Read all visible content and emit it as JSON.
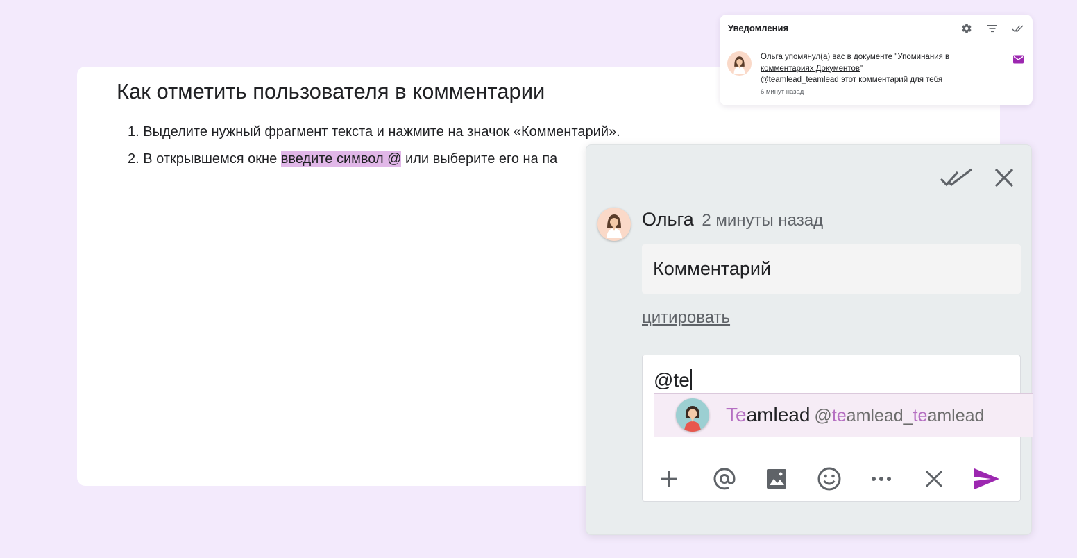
{
  "document": {
    "title": "Как отметить пользователя в комментарии",
    "steps": [
      {
        "number": "1.",
        "text": "Выделите нужный фрагмент текста и нажмите на значок «Комментарий»."
      },
      {
        "number": "2.",
        "before": "В открывшемся окне",
        "highlight": "введите символ @",
        "after": "или выберите его на па"
      }
    ]
  },
  "notifications": {
    "title": "Уведомления",
    "icons": [
      "gear-icon",
      "filter-icon",
      "mark-all-read-icon"
    ],
    "item": {
      "text_prefix": "Ольга упомянул(а) вас в документе \"",
      "doc_link": "Упоминания в комментариях Документов",
      "text_suffix": "\"",
      "message": "@teamlead_teamlead этот комментарий для тебя",
      "time": "6 минут назад",
      "status_icon": "mail-icon"
    }
  },
  "comment": {
    "author": "Ольга",
    "time": "2 минуты назад",
    "text": "Комментарий",
    "quote_label": "цитировать",
    "input_value": "@te",
    "suggestion": {
      "name_match": "Te",
      "name_rest": "amlead",
      "handle_at": "@",
      "handle_match1": "te",
      "handle_mid": "amlead_",
      "handle_match2": "te",
      "handle_end": "amlead"
    },
    "toolbar": [
      "plus-icon",
      "at-icon",
      "image-icon",
      "emoji-icon",
      "more-icon",
      "close-icon",
      "send-icon"
    ],
    "colors": {
      "accent": "#9c27b0",
      "highlight": "#e1b7e8",
      "match": "#b56fc2",
      "panel_bg": "#e9edee",
      "page_bg": "#f3eafc"
    }
  }
}
